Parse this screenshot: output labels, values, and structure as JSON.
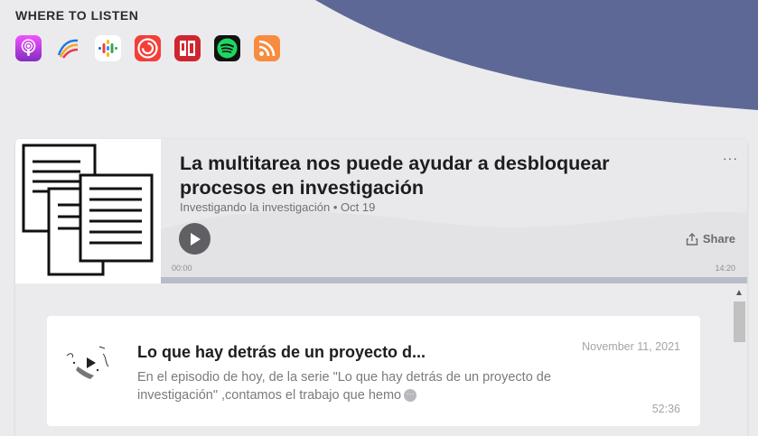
{
  "header": {
    "where_to_listen": "WHERE TO LISTEN",
    "platforms": [
      {
        "name": "apple-podcasts-icon",
        "color": "#a656e0"
      },
      {
        "name": "castbox-icon",
        "color": "#f55b23"
      },
      {
        "name": "google-podcasts-icon",
        "color": "#ffffff"
      },
      {
        "name": "pocket-casts-icon",
        "color": "#f43e37"
      },
      {
        "name": "radio-public-icon",
        "color": "#ce262f"
      },
      {
        "name": "spotify-icon",
        "color": "#1ed760"
      },
      {
        "name": "rss-icon",
        "color": "#f78c40"
      }
    ]
  },
  "episode": {
    "title": "La multitarea nos puede ayudar a desbloquear procesos en investigación",
    "podcast": "Investigando la investigación",
    "date": "Oct 19",
    "more": "···",
    "share_label": "Share",
    "time_start": "00:00",
    "time_end": "14:20"
  },
  "list": {
    "items": [
      {
        "title": "Lo que hay detrás de un proyecto d...",
        "date": "November 11, 2021",
        "description": "En el episodio de hoy, de la serie \"Lo que hay detrás de un proyecto de investigación\" ,contamos el trabajo que hemo",
        "duration": "52:36"
      }
    ]
  },
  "colors": {
    "background": "#ebebed",
    "wave": "#5d6896",
    "player_bg": "#e9e9eb",
    "progress": "#b8bcc9"
  }
}
